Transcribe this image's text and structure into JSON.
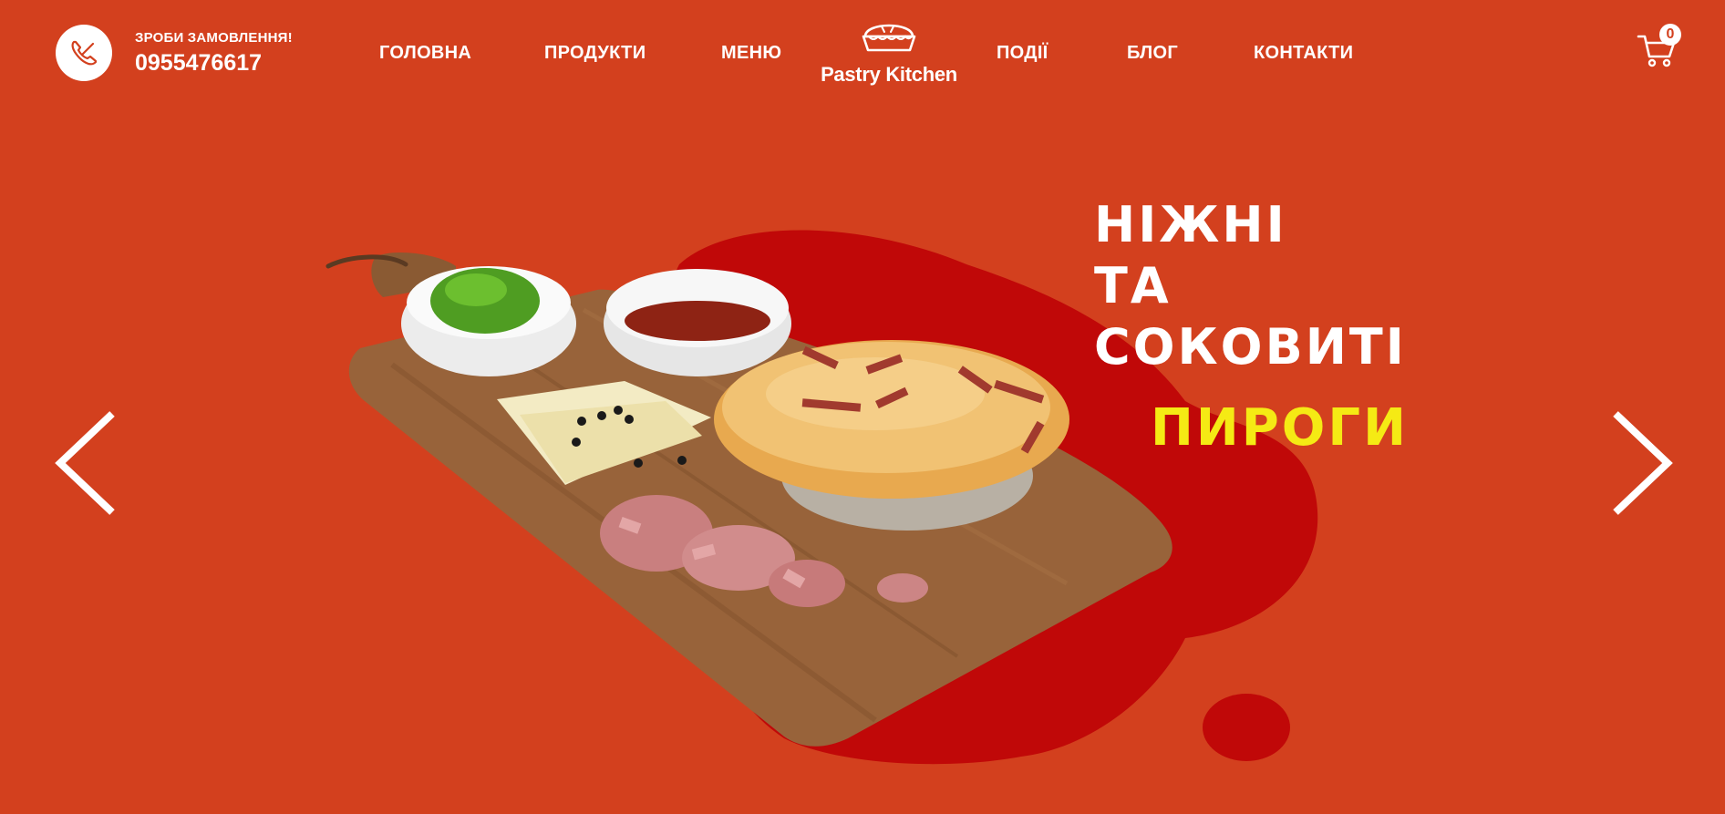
{
  "header": {
    "order_label": "ЗРОБИ ЗАМОВЛЕННЯ!",
    "phone": "0955476617",
    "logo_text": "Pastry Kitchen",
    "cart_count": "0"
  },
  "nav": {
    "items": [
      {
        "label": "ГОЛОВНА"
      },
      {
        "label": "ПРОДУКТИ"
      },
      {
        "label": "МЕНЮ"
      },
      {
        "label": "ПОДІЇ"
      },
      {
        "label": "БЛОГ"
      },
      {
        "label": "КОНТАКТИ"
      }
    ]
  },
  "hero": {
    "line1": "НІЖНІ",
    "line2": "ТА",
    "line3": "СОКОВИТІ",
    "accent": "ПИРОГИ"
  },
  "colors": {
    "background": "#d3401e",
    "blob": "#c00808",
    "accent": "#f5ea14",
    "text": "#ffffff"
  }
}
